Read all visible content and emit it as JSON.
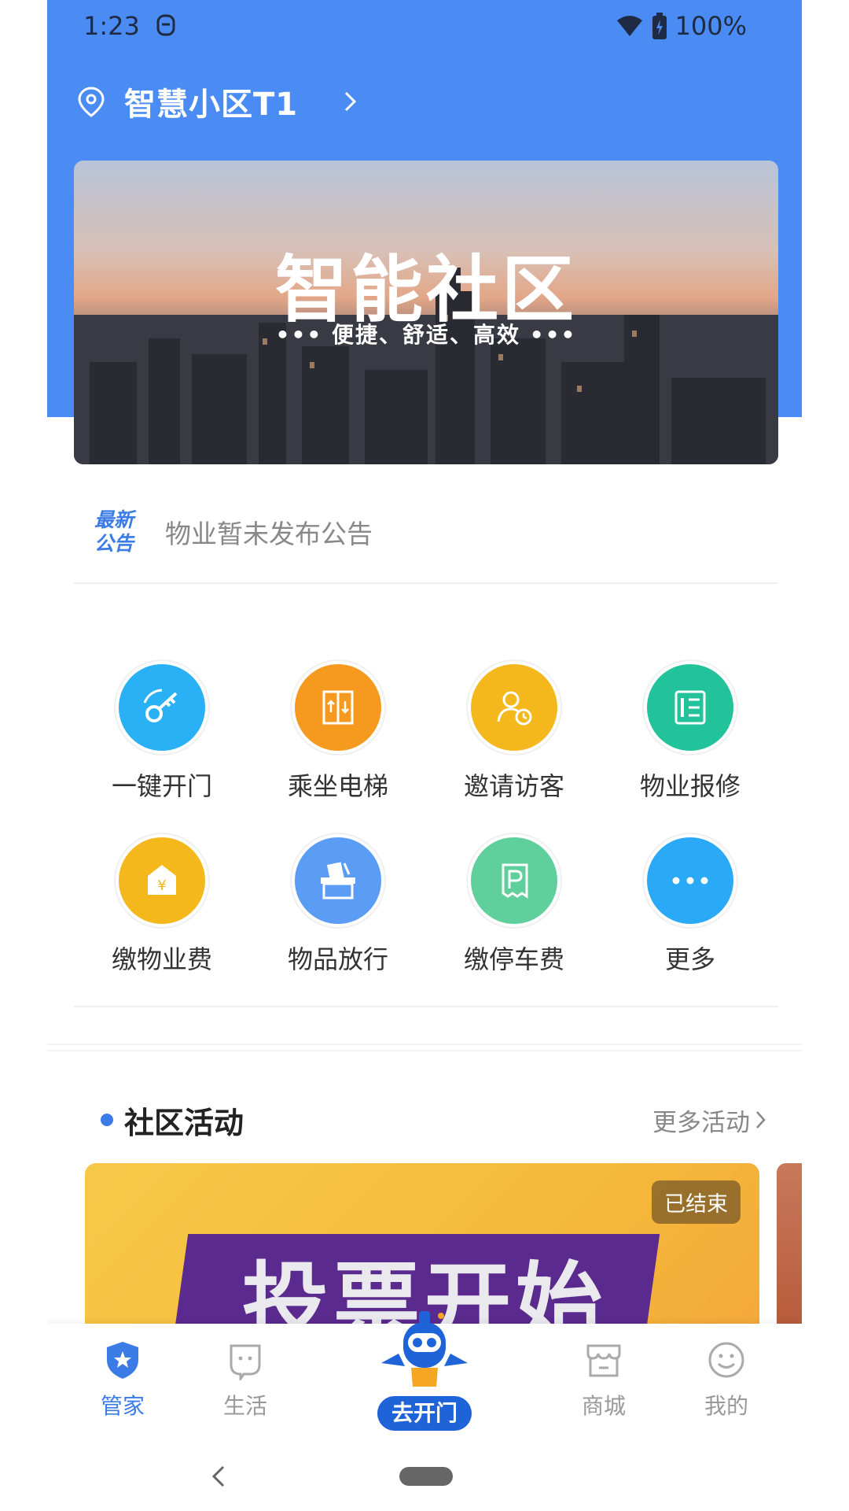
{
  "status_bar": {
    "time": "1:23",
    "battery": "100%"
  },
  "header": {
    "community_name": "智慧小区T1"
  },
  "banner": {
    "title": "智能社区",
    "subtitle": "••• 便捷、舒适、高效 •••"
  },
  "notice": {
    "tag_line1": "最新",
    "tag_line2": "公告",
    "text": "物业暂未发布公告"
  },
  "grid": {
    "items": [
      {
        "label": "一键开门",
        "color": "#2ab0f5",
        "icon": "key-icon"
      },
      {
        "label": "乘坐电梯",
        "color": "#f59a1e",
        "icon": "elevator-icon"
      },
      {
        "label": "邀请访客",
        "color": "#f5b81c",
        "icon": "visitor-icon"
      },
      {
        "label": "物业报修",
        "color": "#22c39a",
        "icon": "repair-icon"
      },
      {
        "label": "缴物业费",
        "color": "#f5b81c",
        "icon": "fee-icon"
      },
      {
        "label": "物品放行",
        "color": "#5b9cf4",
        "icon": "release-icon"
      },
      {
        "label": "缴停车费",
        "color": "#5fcf9b",
        "icon": "parking-icon"
      },
      {
        "label": "更多",
        "color": "#2aa9f7",
        "icon": "more-icon"
      }
    ]
  },
  "activity": {
    "section_title": "社区活动",
    "more_label": "更多活动",
    "card_badge": "已结束",
    "card_poster": "投票开始"
  },
  "tabbar": {
    "tabs": [
      {
        "label": "管家",
        "active": true
      },
      {
        "label": "生活",
        "active": false
      },
      {
        "label": "去开门",
        "active": false
      },
      {
        "label": "商城",
        "active": false
      },
      {
        "label": "我的",
        "active": false
      }
    ]
  },
  "colors": {
    "primary": "#4a8cf4",
    "accent": "#3b7be6"
  }
}
